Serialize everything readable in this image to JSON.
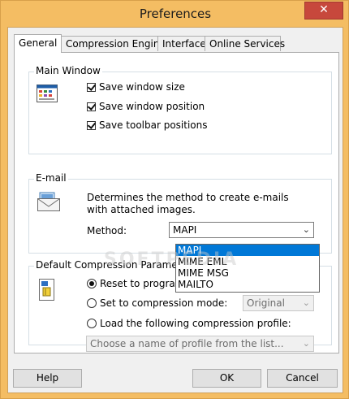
{
  "window": {
    "title": "Preferences",
    "close_glyph": "✕"
  },
  "tabs": [
    {
      "label": "General"
    },
    {
      "label": "Compression Engine"
    },
    {
      "label": "Interface"
    },
    {
      "label": "Online Services"
    }
  ],
  "main_window": {
    "label": "Main Window",
    "options": [
      {
        "label": "Save window size",
        "checked": true
      },
      {
        "label": "Save window position",
        "checked": true
      },
      {
        "label": "Save toolbar positions",
        "checked": true
      }
    ]
  },
  "email": {
    "label": "E-mail",
    "description": "Determines the method to create e-mails with attached images.",
    "method_label": "Method:",
    "method_value": "MAPI",
    "options": [
      "MAPI",
      "MIME EML",
      "MIME MSG",
      "MAILTO"
    ]
  },
  "compression": {
    "label": "Default Compression Paramete",
    "reset_label": "Reset to program",
    "set_mode_label": "Set to compression mode:",
    "mode_value": "Original",
    "load_profile_label": "Load the following compression profile:",
    "profile_placeholder": "Choose a name of profile from the list..."
  },
  "buttons": {
    "help": "Help",
    "ok": "OK",
    "cancel": "Cancel"
  },
  "watermark": "SOFTPEDIA",
  "colors": {
    "frame": "#f4bd63",
    "close": "#c7483c",
    "selection": "#0078d7"
  },
  "icons": [
    "window-icon",
    "email-icon",
    "compression-icon",
    "chevron-down-icon"
  ]
}
